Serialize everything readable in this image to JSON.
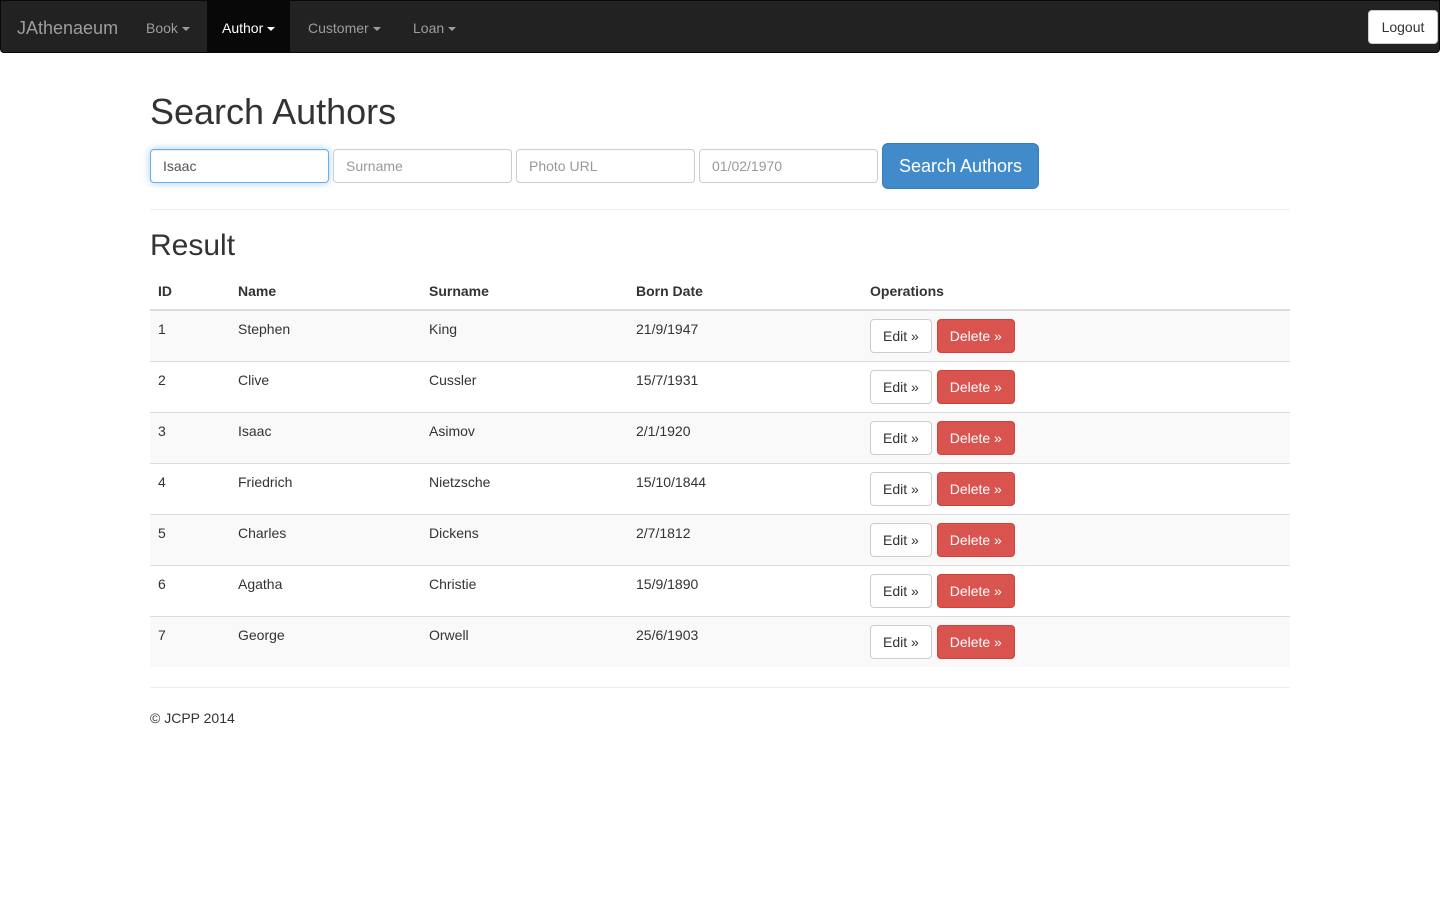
{
  "navbar": {
    "brand": "JAthenaeum",
    "items": [
      {
        "label": "Book",
        "active": false
      },
      {
        "label": "Author",
        "active": true
      },
      {
        "label": "Customer",
        "active": false
      },
      {
        "label": "Loan",
        "active": false
      }
    ],
    "logout_label": "Logout"
  },
  "search": {
    "title": "Search Authors",
    "name_value": "Isaac",
    "surname_placeholder": "Surname",
    "photo_placeholder": "Photo URL",
    "date_placeholder": "01/02/1970",
    "button_label": "Search Authors"
  },
  "result": {
    "title": "Result",
    "columns": [
      "ID",
      "Name",
      "Surname",
      "Born Date",
      "Operations"
    ],
    "edit_label": "Edit »",
    "delete_label": "Delete »",
    "rows": [
      {
        "id": "1",
        "name": "Stephen",
        "surname": "King",
        "born": "21/9/1947"
      },
      {
        "id": "2",
        "name": "Clive",
        "surname": "Cussler",
        "born": "15/7/1931"
      },
      {
        "id": "3",
        "name": "Isaac",
        "surname": "Asimov",
        "born": "2/1/1920"
      },
      {
        "id": "4",
        "name": "Friedrich",
        "surname": "Nietzsche",
        "born": "15/10/1844"
      },
      {
        "id": "5",
        "name": "Charles",
        "surname": "Dickens",
        "born": "2/7/1812"
      },
      {
        "id": "6",
        "name": "Agatha",
        "surname": "Christie",
        "born": "15/9/1890"
      },
      {
        "id": "7",
        "name": "George",
        "surname": "Orwell",
        "born": "25/6/1903"
      }
    ]
  },
  "footer": {
    "copyright": "© JCPP 2014"
  },
  "colors": {
    "navbar_bg": "#222222",
    "primary": "#428bca",
    "danger": "#d9534f"
  }
}
